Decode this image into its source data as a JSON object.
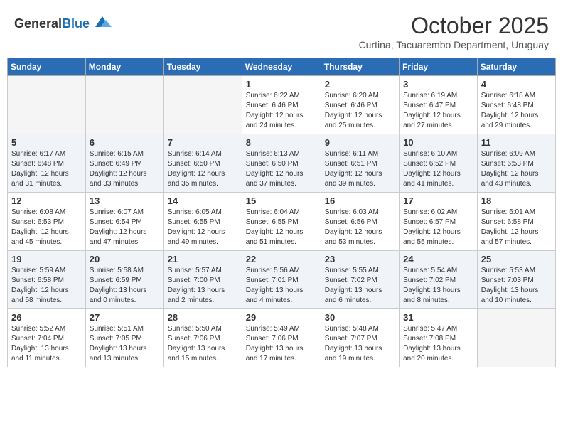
{
  "header": {
    "logo_general": "General",
    "logo_blue": "Blue",
    "month_title": "October 2025",
    "subtitle": "Curtina, Tacuarembo Department, Uruguay"
  },
  "weekdays": [
    "Sunday",
    "Monday",
    "Tuesday",
    "Wednesday",
    "Thursday",
    "Friday",
    "Saturday"
  ],
  "weeks": [
    [
      {
        "day": "",
        "info": ""
      },
      {
        "day": "",
        "info": ""
      },
      {
        "day": "",
        "info": ""
      },
      {
        "day": "1",
        "info": "Sunrise: 6:22 AM\nSunset: 6:46 PM\nDaylight: 12 hours\nand 24 minutes."
      },
      {
        "day": "2",
        "info": "Sunrise: 6:20 AM\nSunset: 6:46 PM\nDaylight: 12 hours\nand 25 minutes."
      },
      {
        "day": "3",
        "info": "Sunrise: 6:19 AM\nSunset: 6:47 PM\nDaylight: 12 hours\nand 27 minutes."
      },
      {
        "day": "4",
        "info": "Sunrise: 6:18 AM\nSunset: 6:48 PM\nDaylight: 12 hours\nand 29 minutes."
      }
    ],
    [
      {
        "day": "5",
        "info": "Sunrise: 6:17 AM\nSunset: 6:48 PM\nDaylight: 12 hours\nand 31 minutes."
      },
      {
        "day": "6",
        "info": "Sunrise: 6:15 AM\nSunset: 6:49 PM\nDaylight: 12 hours\nand 33 minutes."
      },
      {
        "day": "7",
        "info": "Sunrise: 6:14 AM\nSunset: 6:50 PM\nDaylight: 12 hours\nand 35 minutes."
      },
      {
        "day": "8",
        "info": "Sunrise: 6:13 AM\nSunset: 6:50 PM\nDaylight: 12 hours\nand 37 minutes."
      },
      {
        "day": "9",
        "info": "Sunrise: 6:11 AM\nSunset: 6:51 PM\nDaylight: 12 hours\nand 39 minutes."
      },
      {
        "day": "10",
        "info": "Sunrise: 6:10 AM\nSunset: 6:52 PM\nDaylight: 12 hours\nand 41 minutes."
      },
      {
        "day": "11",
        "info": "Sunrise: 6:09 AM\nSunset: 6:53 PM\nDaylight: 12 hours\nand 43 minutes."
      }
    ],
    [
      {
        "day": "12",
        "info": "Sunrise: 6:08 AM\nSunset: 6:53 PM\nDaylight: 12 hours\nand 45 minutes."
      },
      {
        "day": "13",
        "info": "Sunrise: 6:07 AM\nSunset: 6:54 PM\nDaylight: 12 hours\nand 47 minutes."
      },
      {
        "day": "14",
        "info": "Sunrise: 6:05 AM\nSunset: 6:55 PM\nDaylight: 12 hours\nand 49 minutes."
      },
      {
        "day": "15",
        "info": "Sunrise: 6:04 AM\nSunset: 6:55 PM\nDaylight: 12 hours\nand 51 minutes."
      },
      {
        "day": "16",
        "info": "Sunrise: 6:03 AM\nSunset: 6:56 PM\nDaylight: 12 hours\nand 53 minutes."
      },
      {
        "day": "17",
        "info": "Sunrise: 6:02 AM\nSunset: 6:57 PM\nDaylight: 12 hours\nand 55 minutes."
      },
      {
        "day": "18",
        "info": "Sunrise: 6:01 AM\nSunset: 6:58 PM\nDaylight: 12 hours\nand 57 minutes."
      }
    ],
    [
      {
        "day": "19",
        "info": "Sunrise: 5:59 AM\nSunset: 6:58 PM\nDaylight: 12 hours\nand 58 minutes."
      },
      {
        "day": "20",
        "info": "Sunrise: 5:58 AM\nSunset: 6:59 PM\nDaylight: 13 hours\nand 0 minutes."
      },
      {
        "day": "21",
        "info": "Sunrise: 5:57 AM\nSunset: 7:00 PM\nDaylight: 13 hours\nand 2 minutes."
      },
      {
        "day": "22",
        "info": "Sunrise: 5:56 AM\nSunset: 7:01 PM\nDaylight: 13 hours\nand 4 minutes."
      },
      {
        "day": "23",
        "info": "Sunrise: 5:55 AM\nSunset: 7:02 PM\nDaylight: 13 hours\nand 6 minutes."
      },
      {
        "day": "24",
        "info": "Sunrise: 5:54 AM\nSunset: 7:02 PM\nDaylight: 13 hours\nand 8 minutes."
      },
      {
        "day": "25",
        "info": "Sunrise: 5:53 AM\nSunset: 7:03 PM\nDaylight: 13 hours\nand 10 minutes."
      }
    ],
    [
      {
        "day": "26",
        "info": "Sunrise: 5:52 AM\nSunset: 7:04 PM\nDaylight: 13 hours\nand 11 minutes."
      },
      {
        "day": "27",
        "info": "Sunrise: 5:51 AM\nSunset: 7:05 PM\nDaylight: 13 hours\nand 13 minutes."
      },
      {
        "day": "28",
        "info": "Sunrise: 5:50 AM\nSunset: 7:06 PM\nDaylight: 13 hours\nand 15 minutes."
      },
      {
        "day": "29",
        "info": "Sunrise: 5:49 AM\nSunset: 7:06 PM\nDaylight: 13 hours\nand 17 minutes."
      },
      {
        "day": "30",
        "info": "Sunrise: 5:48 AM\nSunset: 7:07 PM\nDaylight: 13 hours\nand 19 minutes."
      },
      {
        "day": "31",
        "info": "Sunrise: 5:47 AM\nSunset: 7:08 PM\nDaylight: 13 hours\nand 20 minutes."
      },
      {
        "day": "",
        "info": ""
      }
    ]
  ]
}
